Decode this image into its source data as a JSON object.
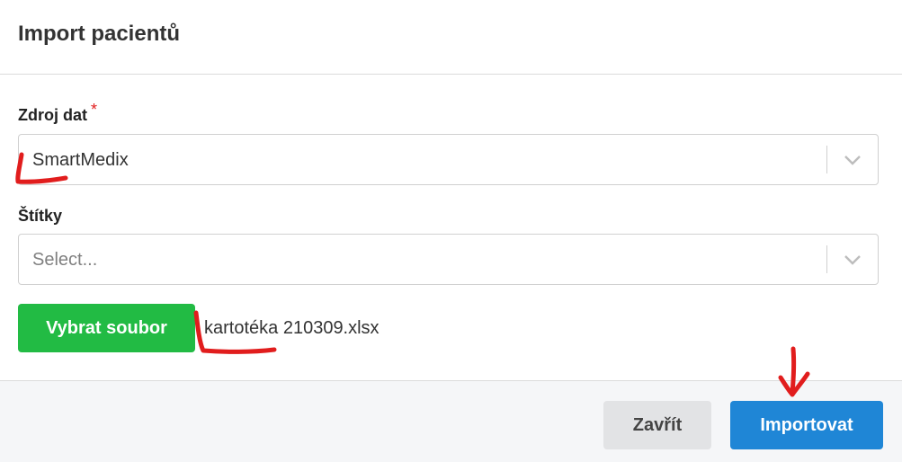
{
  "modal": {
    "title": "Import pacientů"
  },
  "form": {
    "source": {
      "label": "Zdroj dat",
      "required_mark": "*",
      "value": "SmartMedix"
    },
    "tags": {
      "label": "Štítky",
      "placeholder": "Select..."
    },
    "file": {
      "button_label": "Vybrat soubor",
      "file_name": "kartotéka 210309.xlsx"
    }
  },
  "footer": {
    "close_label": "Zavřít",
    "import_label": "Importovat"
  },
  "colors": {
    "primary": "#1f86d6",
    "success": "#22bb44",
    "annotation": "#e11d1d"
  },
  "icons": [
    "chevron-down-icon",
    "chevron-down-icon"
  ]
}
